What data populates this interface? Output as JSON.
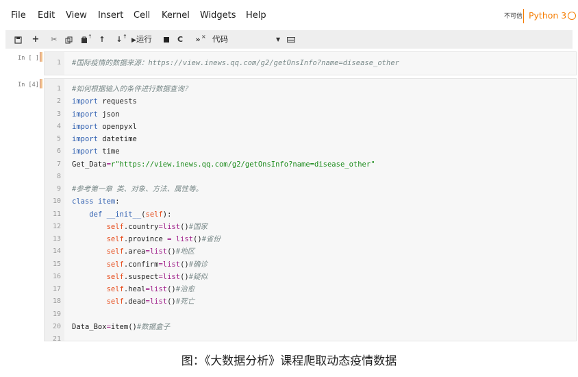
{
  "menu": [
    "File",
    "Edit",
    "View",
    "Insert",
    "Cell",
    "Kernel",
    "Widgets",
    "Help"
  ],
  "status": {
    "trust": "不可信",
    "kernel": "Python 3"
  },
  "toolbar": {
    "save_icon": "save-icon",
    "add_icon": "plus-icon",
    "run_label": "运行",
    "cell_type": "代码"
  },
  "cell1": {
    "prompt": "In [ ]:",
    "lines": [
      {
        "n": "1",
        "parts": [
          [
            "cm",
            "#国际疫情的数据来源：https://view.inews.qq.com/g2/getOnsInfo?name=disease_other"
          ]
        ]
      }
    ]
  },
  "cell2": {
    "prompt": "In [4]:",
    "lines": [
      {
        "n": "1",
        "parts": [
          [
            "cm",
            "#如何根据输入的条件进行数据查询？"
          ]
        ]
      },
      {
        "n": "2",
        "parts": [
          [
            "kw",
            "import"
          ],
          [
            "",
            " requests"
          ]
        ]
      },
      {
        "n": "3",
        "parts": [
          [
            "kw",
            "import"
          ],
          [
            "",
            " json"
          ]
        ]
      },
      {
        "n": "4",
        "parts": [
          [
            "kw",
            "import"
          ],
          [
            "",
            " openpyxl"
          ]
        ]
      },
      {
        "n": "5",
        "parts": [
          [
            "kw",
            "import"
          ],
          [
            "",
            " datetime"
          ]
        ]
      },
      {
        "n": "6",
        "parts": [
          [
            "kw",
            "import"
          ],
          [
            "",
            " time"
          ]
        ]
      },
      {
        "n": "7",
        "parts": [
          [
            "",
            "Get_Data"
          ],
          [
            "op",
            "="
          ],
          [
            "str",
            "r\"https://view.inews.qq.com/g2/getOnsInfo?name=disease_other\""
          ]
        ]
      },
      {
        "n": "8",
        "parts": []
      },
      {
        "n": "9",
        "parts": [
          [
            "cm",
            "#参考第一章 类、对象、方法、属性等。"
          ]
        ]
      },
      {
        "n": "10",
        "parts": [
          [
            "kw",
            "class"
          ],
          [
            "",
            " "
          ],
          [
            "def",
            "item"
          ],
          [
            "",
            ":"
          ]
        ]
      },
      {
        "n": "11",
        "parts": [
          [
            "",
            "    "
          ],
          [
            "kw",
            "def"
          ],
          [
            "",
            " "
          ],
          [
            "def",
            "__init__"
          ],
          [
            "",
            "("
          ],
          [
            "self",
            "self"
          ],
          [
            "",
            "):"
          ]
        ]
      },
      {
        "n": "12",
        "parts": [
          [
            "",
            "        "
          ],
          [
            "self",
            "self"
          ],
          [
            "",
            ".country"
          ],
          [
            "op",
            "="
          ],
          [
            "bi",
            "list"
          ],
          [
            "",
            "()"
          ],
          [
            "cm",
            "#国家"
          ]
        ]
      },
      {
        "n": "13",
        "parts": [
          [
            "",
            "        "
          ],
          [
            "self",
            "self"
          ],
          [
            "",
            ".province "
          ],
          [
            "op",
            "="
          ],
          [
            "",
            " "
          ],
          [
            "bi",
            "list"
          ],
          [
            "",
            "()"
          ],
          [
            "cm",
            "#省份"
          ]
        ]
      },
      {
        "n": "14",
        "parts": [
          [
            "",
            "        "
          ],
          [
            "self",
            "self"
          ],
          [
            "",
            ".area"
          ],
          [
            "op",
            "="
          ],
          [
            "bi",
            "list"
          ],
          [
            "",
            "()"
          ],
          [
            "cm",
            "#地区"
          ]
        ]
      },
      {
        "n": "15",
        "parts": [
          [
            "",
            "        "
          ],
          [
            "self",
            "self"
          ],
          [
            "",
            ".confirm"
          ],
          [
            "op",
            "="
          ],
          [
            "bi",
            "list"
          ],
          [
            "",
            "()"
          ],
          [
            "cm",
            "#确诊"
          ]
        ]
      },
      {
        "n": "16",
        "parts": [
          [
            "",
            "        "
          ],
          [
            "self",
            "self"
          ],
          [
            "",
            ".suspect"
          ],
          [
            "op",
            "="
          ],
          [
            "bi",
            "list"
          ],
          [
            "",
            "()"
          ],
          [
            "cm",
            "#疑似"
          ]
        ]
      },
      {
        "n": "17",
        "parts": [
          [
            "",
            "        "
          ],
          [
            "self",
            "self"
          ],
          [
            "",
            ".heal"
          ],
          [
            "op",
            "="
          ],
          [
            "bi",
            "list"
          ],
          [
            "",
            "()"
          ],
          [
            "cm",
            "#治愈"
          ]
        ]
      },
      {
        "n": "18",
        "parts": [
          [
            "",
            "        "
          ],
          [
            "self",
            "self"
          ],
          [
            "",
            ".dead"
          ],
          [
            "op",
            "="
          ],
          [
            "bi",
            "list"
          ],
          [
            "",
            "()"
          ],
          [
            "cm",
            "#死亡"
          ]
        ]
      },
      {
        "n": "19",
        "parts": []
      },
      {
        "n": "20",
        "parts": [
          [
            "",
            "Data_Box"
          ],
          [
            "op",
            "="
          ],
          [
            "",
            "item()"
          ],
          [
            "cm",
            "#数据盒子"
          ]
        ]
      },
      {
        "n": "21",
        "parts": []
      }
    ]
  },
  "caption": "图：《大数据分析》课程爬取动态疫情数据",
  "colors": {
    "kernel_accent": "#f57c00",
    "keyword": "#2f5fb0",
    "string": "#1a8a1a",
    "self": "#e64a19"
  }
}
